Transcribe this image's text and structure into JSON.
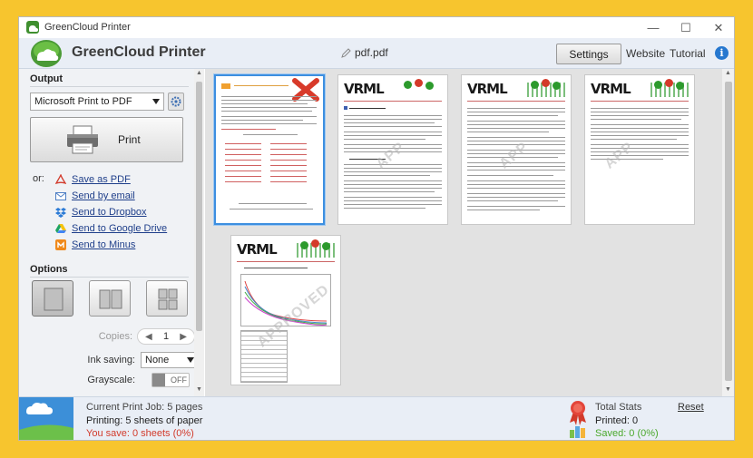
{
  "window": {
    "title": "GreenCloud Printer",
    "minimize": "—",
    "maximize": "☐",
    "close": "✕"
  },
  "header": {
    "app_name": "GreenCloud Printer",
    "file_name": "pdf.pdf",
    "settings": "Settings",
    "website": "Website",
    "tutorial": "Tutorial",
    "info": "i"
  },
  "output": {
    "title": "Output",
    "printer": "Microsoft Print to PDF",
    "print_label": "Print",
    "or_label": "or:",
    "send": [
      {
        "label": "Save as PDF",
        "icon": "pdf-icon"
      },
      {
        "label": "Send by email",
        "icon": "email-icon"
      },
      {
        "label": "Send to Dropbox",
        "icon": "dropbox-icon"
      },
      {
        "label": "Send to Google Drive",
        "icon": "google-drive-icon"
      },
      {
        "label": "Send to Minus",
        "icon": "minus-icon"
      }
    ]
  },
  "options": {
    "title": "Options",
    "copies_label": "Copies:",
    "copies_value": "1",
    "ink_label": "Ink saving:",
    "ink_value": "None",
    "grayscale_label": "Grayscale:",
    "grayscale_value": "OFF"
  },
  "bottom": {
    "job": "Current Print Job: 5 pages",
    "printing": "Printing: 5 sheets of paper",
    "saving": "You save: 0 sheets (0%)",
    "stats_title": "Total Stats",
    "reset": "Reset",
    "printed": "Printed: 0",
    "saved": "Saved: 0 (0%)"
  },
  "colors": {
    "accent_blue": "#3d8fe0",
    "link": "#1f3f8a",
    "red_text": "#d23a2b",
    "green_text": "#4aa82b",
    "background": "#f7c52e"
  }
}
